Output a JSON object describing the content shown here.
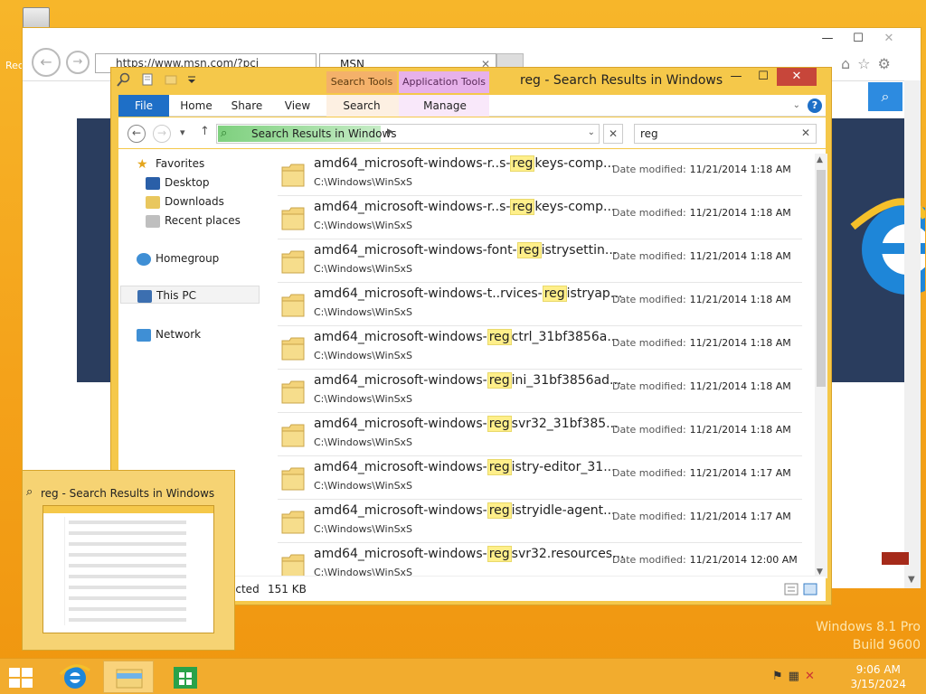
{
  "desktop": {
    "recycle_label": "Rec"
  },
  "ie": {
    "address": "https://www.msn.com/?pci",
    "tab_label": "MSN",
    "tab_close": "✕",
    "ctrl_min": "—",
    "ctrl_max": "☐",
    "ctrl_close": "✕",
    "icons": "⌂☆⚙"
  },
  "explorer": {
    "title": "reg - Search Results in Windows",
    "ctx_search": "Search Tools",
    "ctx_app": "Application Tools",
    "ctrl_min": "—",
    "ctrl_max": "☐",
    "ctrl_close": "✕",
    "ribbon": {
      "file": "File",
      "home": "Home",
      "share": "Share",
      "view": "View",
      "search": "Search",
      "manage": "Manage",
      "help": "?"
    },
    "address": "Search Results in Windows",
    "search_value": "reg",
    "nav": {
      "favorites": "Favorites",
      "desktop": "Desktop",
      "downloads": "Downloads",
      "recent": "Recent places",
      "homegroup": "Homegroup",
      "thispc": "This PC",
      "network": "Network"
    },
    "date_label": "Date modified:",
    "results": [
      {
        "pre": "amd64_microsoft-windows-r..s-",
        "hl": "reg",
        "post": "keys-comp...",
        "path": "C:\\Windows\\WinSxS",
        "date": "11/21/2014 1:18 AM"
      },
      {
        "pre": "amd64_microsoft-windows-r..s-",
        "hl": "reg",
        "post": "keys-comp...",
        "path": "C:\\Windows\\WinSxS",
        "date": "11/21/2014 1:18 AM"
      },
      {
        "pre": "amd64_microsoft-windows-font-",
        "hl": "reg",
        "post": "istrysettin...",
        "path": "C:\\Windows\\WinSxS",
        "date": "11/21/2014 1:18 AM"
      },
      {
        "pre": "amd64_microsoft-windows-t..rvices-",
        "hl": "reg",
        "post": "istryap...",
        "path": "C:\\Windows\\WinSxS",
        "date": "11/21/2014 1:18 AM"
      },
      {
        "pre": "amd64_microsoft-windows-",
        "hl": "reg",
        "post": "ctrl_31bf3856a...",
        "path": "C:\\Windows\\WinSxS",
        "date": "11/21/2014 1:18 AM"
      },
      {
        "pre": "amd64_microsoft-windows-",
        "hl": "reg",
        "post": "ini_31bf3856ad...",
        "path": "C:\\Windows\\WinSxS",
        "date": "11/21/2014 1:18 AM"
      },
      {
        "pre": "amd64_microsoft-windows-",
        "hl": "reg",
        "post": "svr32_31bf385...",
        "path": "C:\\Windows\\WinSxS",
        "date": "11/21/2014 1:18 AM"
      },
      {
        "pre": "amd64_microsoft-windows-",
        "hl": "reg",
        "post": "istry-editor_31...",
        "path": "C:\\Windows\\WinSxS",
        "date": "11/21/2014 1:17 AM"
      },
      {
        "pre": "amd64_microsoft-windows-",
        "hl": "reg",
        "post": "istryidle-agent...",
        "path": "C:\\Windows\\WinSxS",
        "date": "11/21/2014 1:17 AM"
      },
      {
        "pre": "amd64_microsoft-windows-",
        "hl": "reg",
        "post": "svr32.resources...",
        "path": "C:\\Windows\\WinSxS",
        "date": "11/21/2014 12:00 AM"
      }
    ],
    "status_selected": "ected",
    "status_size": "151 KB"
  },
  "thumbnail": {
    "title": "reg - Search Results in Windows"
  },
  "watermark": {
    "line1": "Windows 8.1 Pro",
    "line2": "Build 9600"
  },
  "clock": {
    "time": "9:06 AM",
    "date": "3/15/2024"
  }
}
